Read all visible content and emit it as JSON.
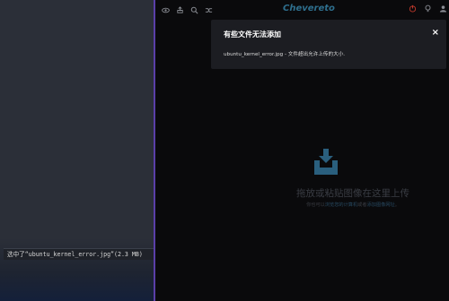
{
  "file_manager": {
    "status_text": "选中了“ubuntu_kernel_error.jpg”(2.3 MB)"
  },
  "site": {
    "logo_text": "Chevereto",
    "toolbar_left_icons": [
      "eye-icon",
      "cloud-upload-icon",
      "search-icon",
      "shuffle-icon"
    ],
    "toolbar_right_icons": [
      "power-icon",
      "lightbulb-icon",
      "user-icon"
    ],
    "colors": {
      "accent": "#2e6f8e",
      "alert": "#c0392b"
    }
  },
  "modal": {
    "title": "有些文件无法添加",
    "close_label": "×",
    "message": "ubuntu_kernel_error.jpg - 文件超出允许上传的大小."
  },
  "dropzone": {
    "title": "拖放或粘贴图像在这里上传",
    "sub_before": "你也可以",
    "link1": "浏览您的计算机",
    "sub_middle": "或者",
    "link2": "添加图像网址",
    "sub_after": "。"
  }
}
